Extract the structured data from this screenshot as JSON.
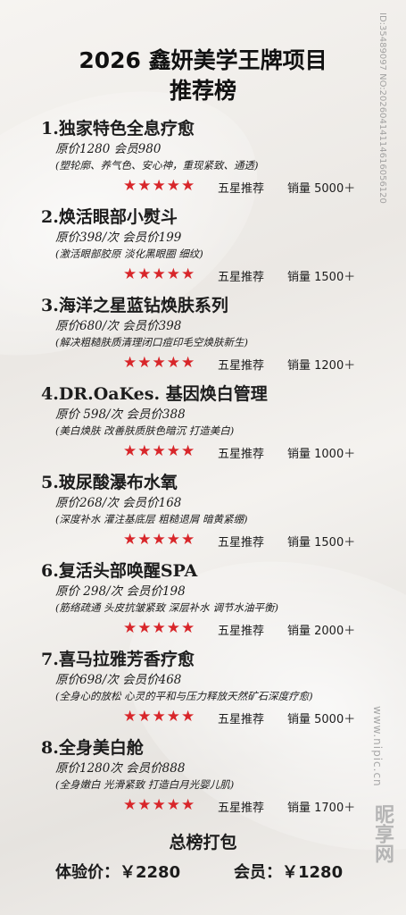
{
  "header": {
    "title_line1": "2026 鑫妍美学王牌项目",
    "title_line2": "推荐榜"
  },
  "items": [
    {
      "title": "1.独家特色全息疗愈",
      "price": "原价1280 会员980",
      "desc": "(塑轮廓、养气色、安心神，重现紧致、通透)",
      "stars": "★★★★★",
      "recommend": "五星推荐",
      "sales": "销量 5000＋"
    },
    {
      "title": "2.焕活眼部小熨斗",
      "price": "原价398/次 会员价199",
      "desc": "(激活眼部胶原 淡化黑眼圈 细纹)",
      "stars": "★★★★★",
      "recommend": "五星推荐",
      "sales": "销量 1500＋"
    },
    {
      "title": "3.海洋之星蓝钻焕肤系列",
      "price": "原价680/次 会员价398",
      "desc": "(解决粗糙肤质清理闭口痘印毛空焕肤新生)",
      "stars": "★★★★★",
      "recommend": "五星推荐",
      "sales": "销量 1200＋"
    },
    {
      "title": "4.DR.OaKes. 基因焕白管理",
      "price": "原价 598/次 会员价388",
      "desc": "(美白焕肤 改善肤质肤色暗沉 打造美白)",
      "stars": "★★★★★",
      "recommend": "五星推荐",
      "sales": "销量 1000＋"
    },
    {
      "title": "5.玻尿酸瀑布水氧",
      "price": "原价268/次 会员价168",
      "desc": "(深度补水 灌注基底层 粗糙退屑 暗黄紧绷)",
      "stars": "★★★★★",
      "recommend": "五星推荐",
      "sales": "销量 1500＋"
    },
    {
      "title": "6.复活头部唤醒SPA",
      "price": "原价 298/次 会员价198",
      "desc": "(筋络疏通 头皮抗皱紧致 深层补水 调节水油平衡)",
      "stars": "★★★★★",
      "recommend": "五星推荐",
      "sales": "销量 2000＋"
    },
    {
      "title": "7.喜马拉雅芳香疗愈",
      "price": "原价698/次 会员价468",
      "desc": "(全身心的放松 心灵的平和与压力释放天然矿石深度疗愈)",
      "stars": "★★★★★",
      "recommend": "五星推荐",
      "sales": "销量 5000＋"
    },
    {
      "title": "8.全身美白舱",
      "price": "原价1280次 会员价888",
      "desc": "(全身嫩白 光滑紧致 打造白月光婴儿肌)",
      "stars": "★★★★★",
      "recommend": "五星推荐",
      "sales": "销量 1700＋"
    }
  ],
  "package": {
    "heading": "总榜打包",
    "trial": "体验价：￥2280",
    "member": "会员：￥1280"
  },
  "watermark": {
    "id": "ID:35489097 NO:20260414114616056120",
    "site": "www.nipic.cn",
    "logo": "昵享网"
  },
  "colors": {
    "star": "#d8262a",
    "text": "#1c1c1c"
  }
}
